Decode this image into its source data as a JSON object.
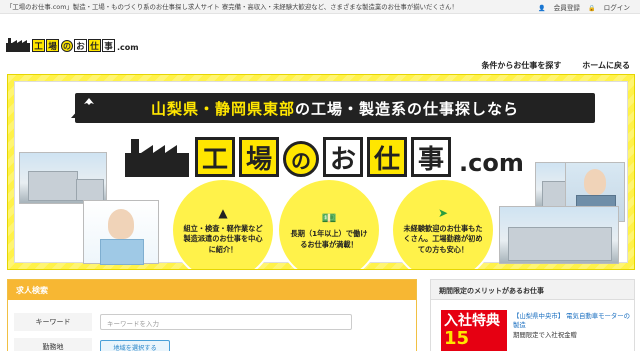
{
  "topbar": {
    "tagline": "「工場のお仕事.com」製造・工場・ものづくり系のお仕事探し求人サイト 寮完備・高収入・未経験大歓迎など、さまざまな製造業のお仕事が揃いだくさん！",
    "register": "会員登録",
    "login": "ログイン"
  },
  "logo": {
    "chars": [
      "工",
      "場",
      "の",
      "お",
      "仕",
      "事"
    ],
    "suffix": ".com"
  },
  "nav": {
    "search_by_condition": "条件からお仕事を探す",
    "home": "ホームに戻る"
  },
  "hero": {
    "banner_part1": "山梨県・静岡県東部",
    "banner_part2": "の工場・製造系の仕事探しなら",
    "logo_chars": [
      "工",
      "場",
      "の",
      "お",
      "仕",
      "事"
    ],
    "logo_suffix": ".com",
    "circle1": "組立・検査・軽作業など製造派遣のお仕事を中心に紹介！",
    "circle2": "長期（1年以上）で働けるお仕事が満載！",
    "circle3": "未経験歓迎のお仕事もたくさん。工場勤務が初めての方も安心！"
  },
  "search": {
    "title": "求人検索",
    "keyword_label": "キーワード",
    "keyword_placeholder": "キーワードを入力",
    "area_label": "勤務地",
    "area_button": "地域を選択する"
  },
  "limited": {
    "title": "期間限定のメリットがあるお仕事",
    "image_text": "入社特典",
    "image_number": "15",
    "location": "【山梨県中央市】",
    "company": "電気自動車モーターの製造",
    "perk": "期間限定で入社祝金贈"
  },
  "colors": {
    "accent_yellow": "#fff24a",
    "search_orange": "#f7b733",
    "dark": "#222222",
    "link_blue": "#1a6fc0"
  },
  "icons": {
    "register": "user-icon",
    "login": "lock-icon",
    "factory": "factory-icon",
    "mountain": "mountain-icon",
    "money": "money-icon",
    "beginner": "beginner-mark-icon"
  }
}
